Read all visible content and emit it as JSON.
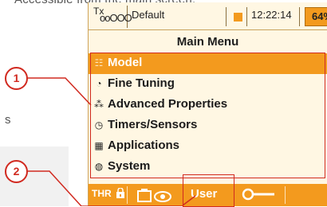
{
  "background_text": {
    "top": "Accessible from the main screen.",
    "side": "s"
  },
  "statusbar": {
    "tx_label": "Tx",
    "tx_signal": "ooOOO",
    "model_name": "Default",
    "time": "12:22:14",
    "battery": "64%"
  },
  "title": "Main Menu",
  "menu": {
    "items": [
      {
        "label": "Model",
        "icon": "model-icon",
        "glyph": "☷"
      },
      {
        "label": "Fine Tuning",
        "icon": "fine-tuning-icon",
        "glyph": "◔"
      },
      {
        "label": "Advanced Properties",
        "icon": "advanced-properties-icon",
        "glyph": "⁂"
      },
      {
        "label": "Timers/Sensors",
        "icon": "timer-icon",
        "glyph": "◷"
      },
      {
        "label": "Applications",
        "icon": "applications-icon",
        "glyph": "▦"
      },
      {
        "label": "System",
        "icon": "system-icon",
        "glyph": "◍"
      }
    ],
    "selected_index": 0
  },
  "bottombar": {
    "thr_label": "THR",
    "user_label": "User"
  },
  "annotations": {
    "callout_1": "1",
    "callout_2": "2"
  },
  "colors": {
    "accent": "#f39a1e",
    "annotation": "#d12a20",
    "screen_bg": "#fff7e3"
  }
}
